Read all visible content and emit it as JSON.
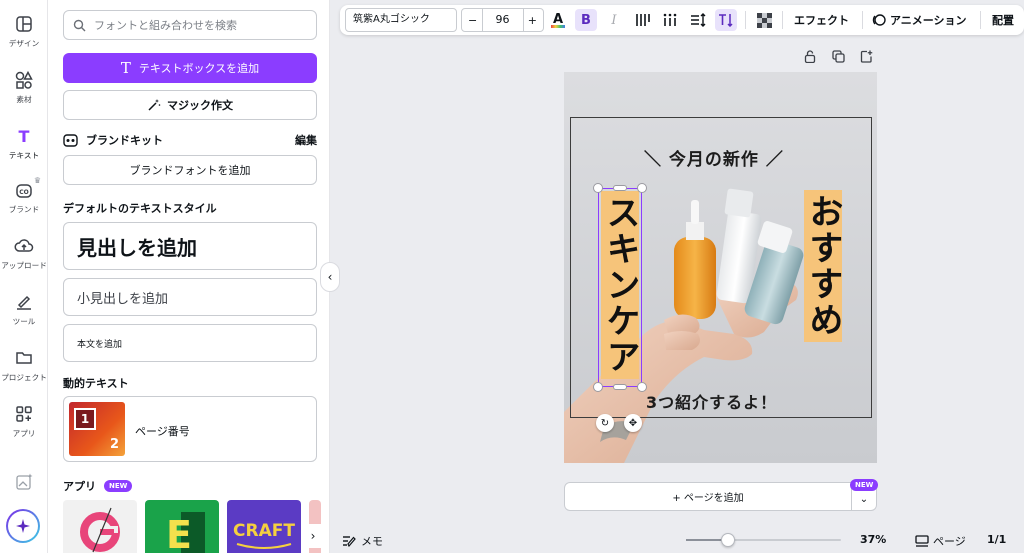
{
  "rail": {
    "items": [
      {
        "label": "デザイン",
        "icon": "layout-icon"
      },
      {
        "label": "素材",
        "icon": "shapes-icon"
      },
      {
        "label": "テキスト",
        "icon": "text-icon"
      },
      {
        "label": "ブランド",
        "icon": "brand-icon"
      },
      {
        "label": "アップロード",
        "icon": "upload-cloud-icon"
      },
      {
        "label": "ツール",
        "icon": "pen-tool-icon"
      },
      {
        "label": "プロジェクト",
        "icon": "folder-icon"
      },
      {
        "label": "アプリ",
        "icon": "apps-grid-icon"
      }
    ],
    "active_index": 2
  },
  "panel": {
    "search_placeholder": "フォントと組み合わせを検索",
    "add_textbox": "テキストボックスを追加",
    "magic_write": "マジック作文",
    "brand_kit": "ブランドキット",
    "brand_edit": "編集",
    "add_brand_font": "ブランドフォントを追加",
    "default_styles_title": "デフォルトのテキストスタイル",
    "heading": "見出しを追加",
    "subheading": "小見出しを追加",
    "body": "本文を追加",
    "dynamic_title": "動的テキスト",
    "page_number": "ページ番号",
    "apps_title": "アプリ",
    "new_badge": "NEW",
    "accent_color": "#8b3dff"
  },
  "toolbar": {
    "font": "筑紫A丸ゴシック",
    "size_minus": "−",
    "size": "96",
    "size_plus": "+",
    "effects": "エフェクト",
    "animation": "アニメーション",
    "position": "配置"
  },
  "canvas": {
    "headline": "＼ 今月の新作 ／",
    "vertical_left": "スキンケア",
    "vertical_right": "おすすめ",
    "bottom": "3つ紹介するよ！",
    "highlight_color": "#f6c47a"
  },
  "add_page": "+ ページを追加",
  "add_page_badge": "NEW",
  "bottom_bar": {
    "memo": "メモ",
    "zoom_percent": 37,
    "zoom": "37%",
    "pages": "ページ",
    "page_count": "1/1"
  }
}
